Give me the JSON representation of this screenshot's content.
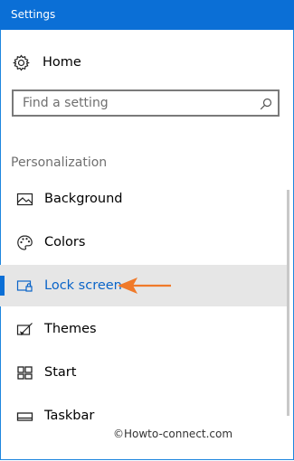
{
  "window": {
    "title": "Settings"
  },
  "home": {
    "label": "Home",
    "icon": "gear-icon"
  },
  "search": {
    "placeholder": "Find a setting",
    "icon": "search-icon"
  },
  "section": {
    "title": "Personalization"
  },
  "nav": {
    "items": [
      {
        "label": "Background",
        "icon": "picture-icon",
        "selected": false
      },
      {
        "label": "Colors",
        "icon": "palette-icon",
        "selected": false
      },
      {
        "label": "Lock screen",
        "icon": "lock-screen-icon",
        "selected": true
      },
      {
        "label": "Themes",
        "icon": "themes-brush-icon",
        "selected": false
      },
      {
        "label": "Start",
        "icon": "start-grid-icon",
        "selected": false
      },
      {
        "label": "Taskbar",
        "icon": "taskbar-icon",
        "selected": false
      }
    ]
  },
  "watermark": "©Howto-connect.com",
  "colors": {
    "accent": "#0b6fd6",
    "selected_bg": "#e6e6e6",
    "arrow": "#f07a2a"
  }
}
